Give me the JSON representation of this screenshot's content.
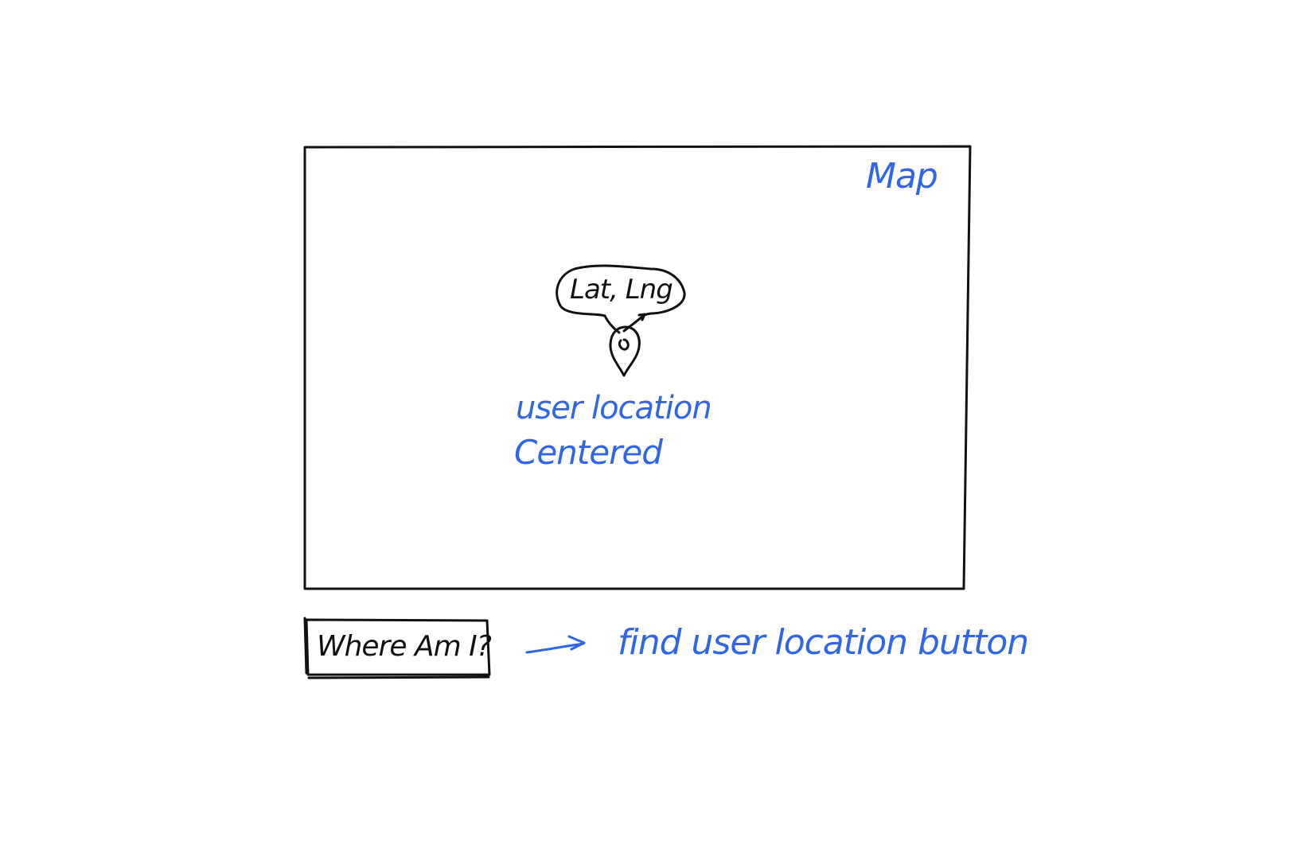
{
  "map": {
    "label": "Map",
    "marker_tooltip": "Lat, Lng",
    "annotation_line1": "user location",
    "annotation_line2": "Centered"
  },
  "footer": {
    "button_label": "Where Am I?",
    "button_annotation": "find user location button"
  },
  "colors": {
    "ink": "#111111",
    "annotation": "#2f66e8"
  },
  "icons": {
    "marker": "map-pin-icon",
    "arrow": "right-arrow-icon"
  }
}
